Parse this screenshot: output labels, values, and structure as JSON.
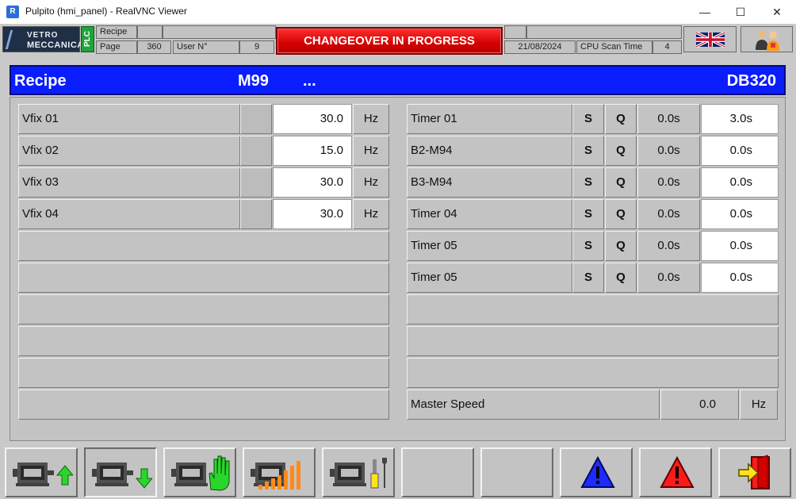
{
  "window": {
    "title": "Pulpito (hmi_panel) - RealVNC Viewer",
    "minimize": "—",
    "maximize": "☐",
    "close": "✕"
  },
  "header": {
    "logo_line1": "VETRO",
    "logo_line2": "MECCANICA",
    "plc": "PLC",
    "recipe_label": "Recipe",
    "page_label": "Page",
    "page_value": "360",
    "user_label": "User N°",
    "user_value": "9",
    "banner": "CHANGEOVER IN PROGRESS",
    "date": "21/08/2024",
    "scan_label": "CPU Scan Time",
    "scan_value": "4"
  },
  "recipe_bar": {
    "title": "Recipe",
    "code": "M99",
    "dots": "...",
    "db": "DB320"
  },
  "left_rows": [
    {
      "label": "Vfix 01",
      "value": "30.0",
      "unit": "Hz"
    },
    {
      "label": "Vfix 02",
      "value": "15.0",
      "unit": "Hz"
    },
    {
      "label": "Vfix 03",
      "value": "30.0",
      "unit": "Hz"
    },
    {
      "label": "Vfix 04",
      "value": "30.0",
      "unit": "Hz"
    }
  ],
  "right_rows": [
    {
      "label": "Timer 01",
      "s": "S",
      "q": "Q",
      "actual": "0.0s",
      "set": "3.0s"
    },
    {
      "label": "B2-M94",
      "s": "S",
      "q": "Q",
      "actual": "0.0s",
      "set": "0.0s"
    },
    {
      "label": "B3-M94",
      "s": "S",
      "q": "Q",
      "actual": "0.0s",
      "set": "0.0s"
    },
    {
      "label": "Timer 04",
      "s": "S",
      "q": "Q",
      "actual": "0.0s",
      "set": "0.0s"
    },
    {
      "label": "Timer 05",
      "s": "S",
      "q": "Q",
      "actual": "0.0s",
      "set": "0.0s"
    },
    {
      "label": "Timer 05",
      "s": "S",
      "q": "Q",
      "actual": "0.0s",
      "set": "0.0s"
    }
  ],
  "master": {
    "label": "Master Speed",
    "value": "0.0",
    "unit": "Hz"
  },
  "toolbar": {
    "icons": [
      "motor-upload-icon",
      "motor-download-icon",
      "motor-manual-icon",
      "motor-speed-icon",
      "motor-tools-icon",
      "empty",
      "empty",
      "blue-warning-icon",
      "red-alarm-icon",
      "exit-door-icon"
    ],
    "colors": {
      "green": "#2bd62b",
      "blue": "#1c2bff",
      "red": "#ff1a1a",
      "orange": "#ff8a1a",
      "yellow": "#ffe21a"
    }
  }
}
